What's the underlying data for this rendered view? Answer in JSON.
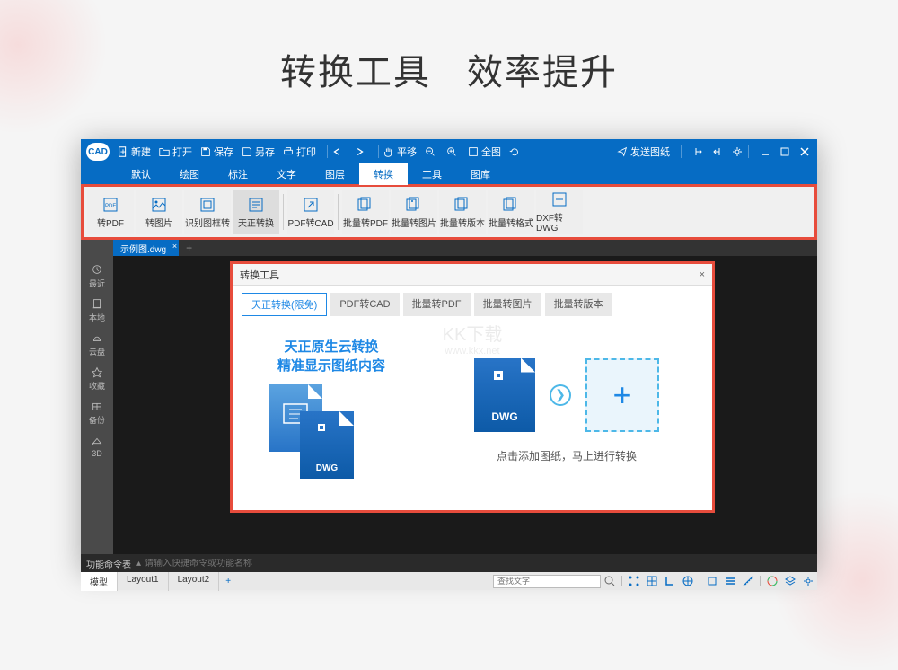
{
  "heading": {
    "part1": "转换工具",
    "part2": "效率提升"
  },
  "titlebar": {
    "new": "新建",
    "open": "打开",
    "save": "保存",
    "saveAs": "另存",
    "print": "打印",
    "pan": "平移",
    "fullscreen": "全图",
    "sendDrawing": "发送图纸"
  },
  "menus": [
    "默认",
    "绘图",
    "标注",
    "文字",
    "图层",
    "转换",
    "工具",
    "图库"
  ],
  "activeMenu": 5,
  "ribbon": [
    "转PDF",
    "转图片",
    "识别图框转",
    "天正转换",
    "PDF转CAD",
    "批量转PDF",
    "批量转图片",
    "批量转版本",
    "批量转格式",
    "DXF转DWG"
  ],
  "ribbonActive": 3,
  "sidebar": [
    {
      "label": "最近"
    },
    {
      "label": "本地"
    },
    {
      "label": "云盘"
    },
    {
      "label": "收藏"
    },
    {
      "label": "备份"
    },
    {
      "label": "3D"
    }
  ],
  "tabs": {
    "file": "示例图.dwg"
  },
  "dialog": {
    "title": "转换工具",
    "tabs": [
      "天正转换(限免)",
      "PDF转CAD",
      "批量转PDF",
      "批量转图片",
      "批量转版本"
    ],
    "activeTab": 0,
    "promoLine1": "天正原生云转换",
    "promoLine2": "精准显示图纸内容",
    "dwgLabel": "DWG",
    "hint": "点击添加图纸，马上进行转换"
  },
  "watermark": {
    "main": "KK下载",
    "sub": "www.kkx.net"
  },
  "cmdbar": {
    "label": "功能命令表",
    "placeholder": "请输入快捷命令或功能名称"
  },
  "status": {
    "tabs": [
      "模型",
      "Layout1",
      "Layout2"
    ],
    "activeTab": 0,
    "searchPlaceholder": "查找文字"
  }
}
